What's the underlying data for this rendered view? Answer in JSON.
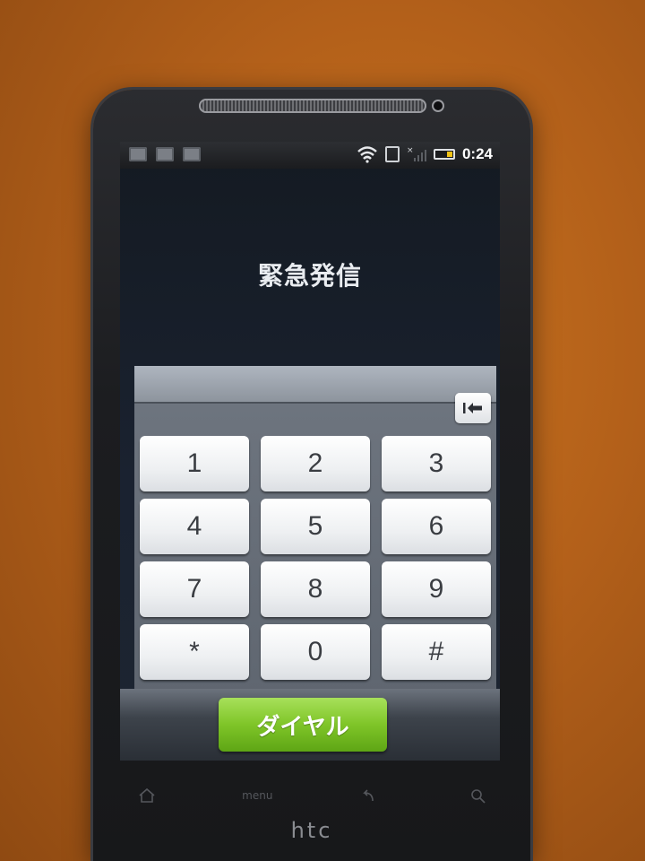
{
  "status_bar": {
    "time": "0:24",
    "left_icons": [
      "notification-icon",
      "shopping-bag-icon",
      "checkbox-icon"
    ],
    "right_icons": [
      "wifi-icon",
      "sim-icon",
      "no-signal-icon",
      "battery-icon"
    ]
  },
  "screen": {
    "title": "緊急発信"
  },
  "dialpad": {
    "keys": [
      "1",
      "2",
      "3",
      "4",
      "5",
      "6",
      "7",
      "8",
      "9",
      "*",
      "0",
      "#"
    ],
    "backspace_icon": "backspace-icon"
  },
  "call": {
    "dial_label": "ダイヤル",
    "button_color": "#7fc528"
  },
  "hardware": {
    "nav_icons": [
      "home-icon",
      "back-icon",
      "search-icon"
    ],
    "menu_label": "menu",
    "brand": "htc"
  }
}
